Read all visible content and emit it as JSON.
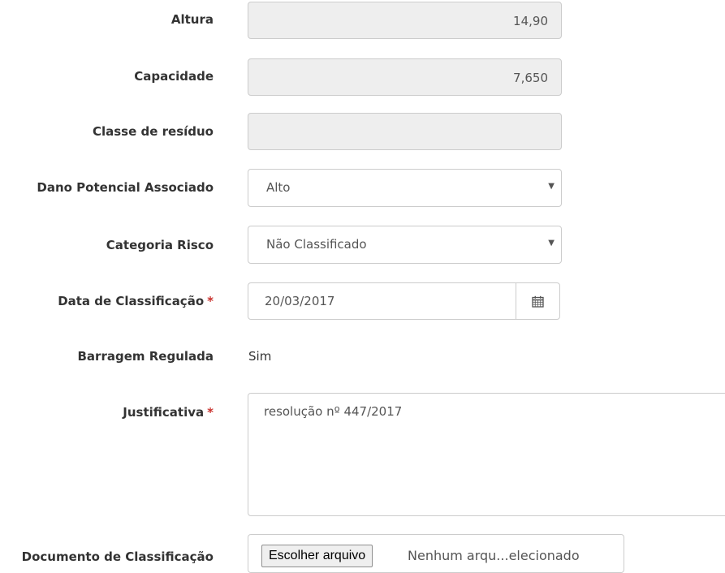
{
  "form": {
    "altura": {
      "label": "Altura",
      "value": "14,90"
    },
    "capacidade": {
      "label": "Capacidade",
      "value": "7,650"
    },
    "classe_residuo": {
      "label": "Classe de resíduo",
      "value": ""
    },
    "dano_potencial": {
      "label": "Dano Potencial Associado",
      "selected": "Alto"
    },
    "categoria_risco": {
      "label": "Categoria Risco",
      "selected": "Não Classificado"
    },
    "data_classificacao": {
      "label": "Data de Classificação",
      "required_mark": "*",
      "value": "20/03/2017",
      "icon": "calendar-icon"
    },
    "barragem_regulada": {
      "label": "Barragem Regulada",
      "value": "Sim"
    },
    "justificativa": {
      "label": "Justificativa",
      "required_mark": "*",
      "value": "resolução nº 447/2017"
    },
    "documento": {
      "label": "Documento de Classificação",
      "button_label": "Escolher arquivo",
      "file_status": "Nenhum arqu...elecionado"
    }
  },
  "colors": {
    "required": "#c9302c",
    "readonly_bg": "#eeeeee",
    "border": "#cccccc"
  }
}
